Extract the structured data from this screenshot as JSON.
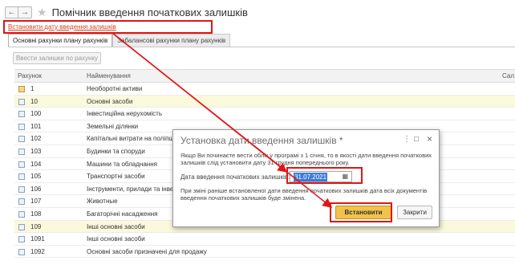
{
  "header": {
    "back_label": "←",
    "forward_label": "→",
    "star_label": "★",
    "title": "Помічник введення початкових залишків"
  },
  "set_date_link": "Встановити дату введення залишків",
  "tabs": [
    {
      "label": "Основні рахунки плану рахунків",
      "active": true
    },
    {
      "label": "Забалансові рахунки плану рахунків",
      "active": false
    }
  ],
  "add_balances_button": "Ввести залишки по рахунку",
  "table": {
    "columns": [
      "Рахунок",
      "Найменування",
      "Сал"
    ],
    "rows": [
      {
        "code": "1",
        "name": "Необоротні активи",
        "icon": "folder-icon",
        "highlight": false
      },
      {
        "code": "10",
        "name": "Основні засоби",
        "icon": "account-icon",
        "highlight": true
      },
      {
        "code": "100",
        "name": "Інвестиційна нерухомість",
        "icon": "account-icon",
        "highlight": false
      },
      {
        "code": "101",
        "name": "Земельні ділянки",
        "icon": "account-icon",
        "highlight": false
      },
      {
        "code": "102",
        "name": "Капітальні витрати на поліпше",
        "icon": "account-icon",
        "highlight": false
      },
      {
        "code": "103",
        "name": "Будинки та споруди",
        "icon": "account-icon",
        "highlight": false
      },
      {
        "code": "104",
        "name": "Машини та обладнання",
        "icon": "account-icon",
        "highlight": false
      },
      {
        "code": "105",
        "name": "Транспортні засоби",
        "icon": "account-icon",
        "highlight": false
      },
      {
        "code": "106",
        "name": "Інструменти, прилади та інвен",
        "icon": "account-icon",
        "highlight": false
      },
      {
        "code": "107",
        "name": "Животные",
        "icon": "account-icon",
        "highlight": false
      },
      {
        "code": "108",
        "name": "Багаторічні насадження",
        "icon": "account-icon",
        "highlight": false
      },
      {
        "code": "109",
        "name": "Інші основні засоби",
        "icon": "account-icon",
        "highlight": true
      },
      {
        "code": "1091",
        "name": "Інші основні засоби",
        "icon": "account-icon",
        "highlight": false
      },
      {
        "code": "1092",
        "name": "Основні засоби призначені для продажу",
        "icon": "account-icon",
        "highlight": false
      }
    ]
  },
  "dialog": {
    "title": "Установка дати введення залишків *",
    "menu_label": "⋮",
    "minimize_label": "□",
    "close_label": "×",
    "info_text": "Якщо Ви починаєте вести облік у програмі з 1 січня, то в якості дати введення початкових залишків слід установити дату 31 грудня попереднього року.",
    "date_label": "Дата введення початкових залишків:",
    "date_value": "31.07.2021",
    "calendar_icon": "▦",
    "note_text": "При зміні раніше встановленої дати введення початкових залишків дата всіх документів введення початкових залишків буде змінена.",
    "ok_button": "Встановити",
    "close_button": "Закрити"
  },
  "colors": {
    "link": "#d8421a",
    "highlight_box": "#e01515",
    "primary_button": "#f3c24b",
    "row_highlight": "#fbf9dc",
    "selected_date": "#3d7bd8"
  }
}
